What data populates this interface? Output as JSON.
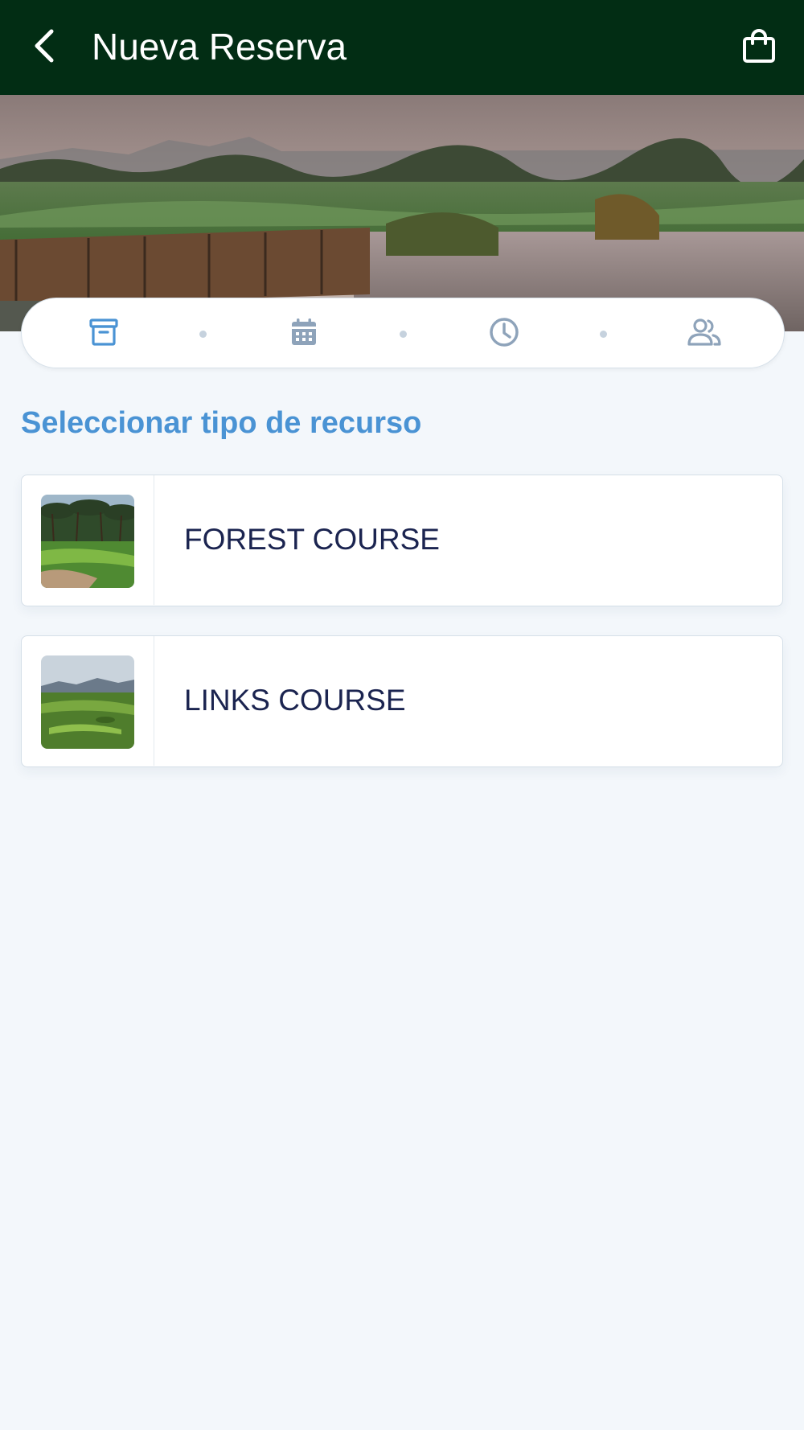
{
  "header": {
    "title": "Nueva Reserva",
    "back_icon": "chevron-left-icon",
    "cart_icon": "shopping-bag-icon",
    "background": "#022d14"
  },
  "stepper": {
    "steps": [
      {
        "icon": "archive-icon",
        "active": true
      },
      {
        "icon": "calendar-icon",
        "active": false
      },
      {
        "icon": "clock-icon",
        "active": false
      },
      {
        "icon": "users-icon",
        "active": false
      }
    ],
    "active_color": "#4a93d4",
    "inactive_color": "#8ea3ba"
  },
  "section": {
    "title": "Seleccionar tipo de recurso"
  },
  "courses": [
    {
      "label": "FOREST COURSE",
      "thumbnail": "forest-course-photo"
    },
    {
      "label": "LINKS COURSE",
      "thumbnail": "links-course-photo"
    }
  ]
}
